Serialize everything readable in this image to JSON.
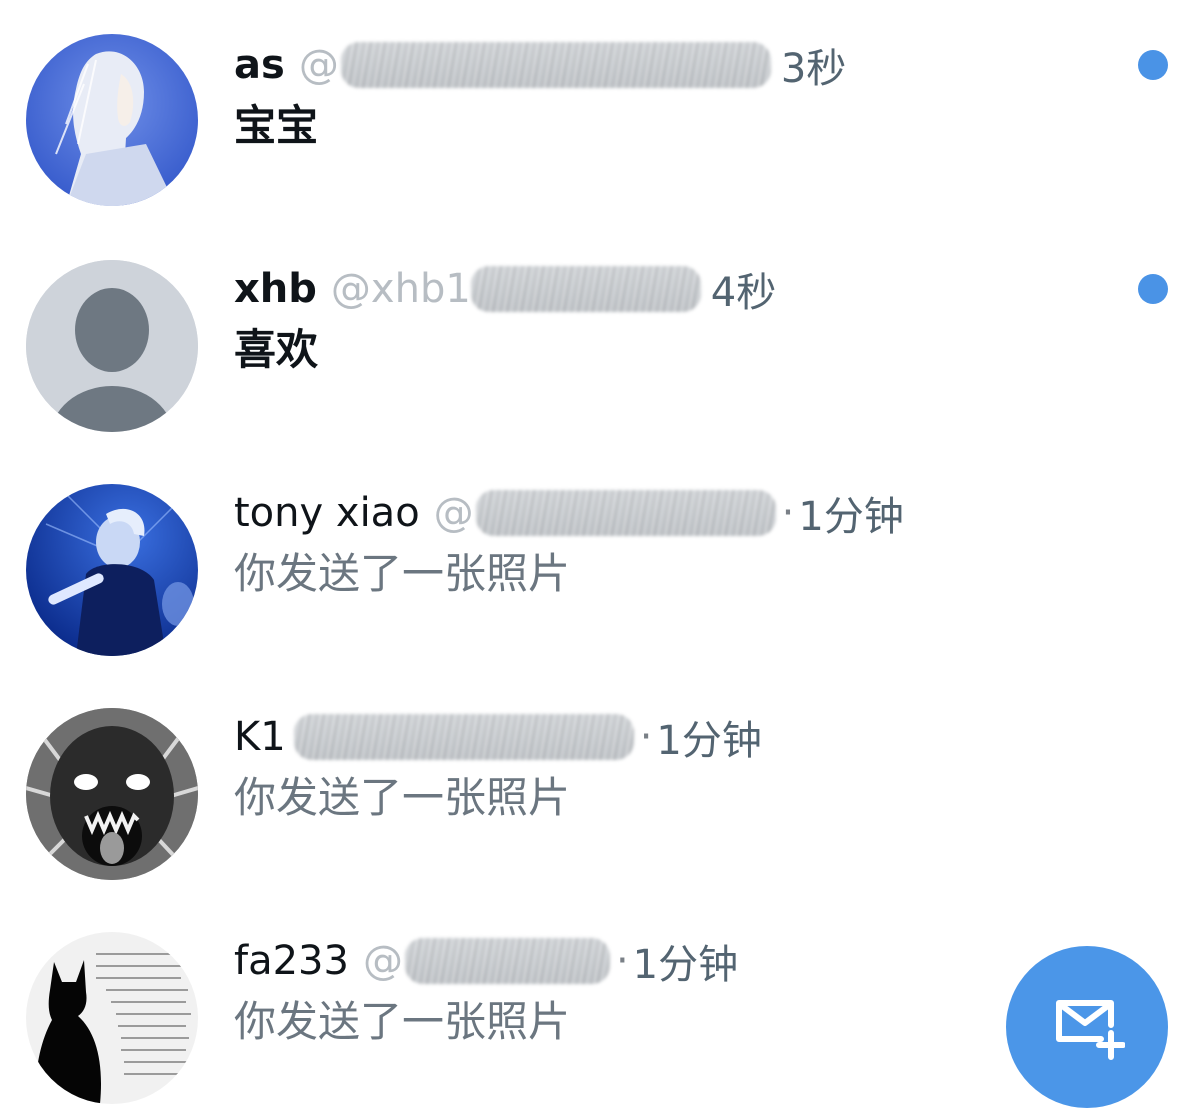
{
  "conversations": [
    {
      "name": "as",
      "handle_visible": "@",
      "separator": "",
      "time": "3秒",
      "preview": "宝宝",
      "unread": true,
      "avatar": "anime-character-avatar"
    },
    {
      "name": "xhb",
      "handle_visible": "@xhb1",
      "separator": "",
      "time": "4秒",
      "preview": "喜欢",
      "unread": true,
      "avatar": "default-person-avatar"
    },
    {
      "name": "tony xiao",
      "handle_visible": "@",
      "separator": "·",
      "time": "1分钟",
      "preview": "你发送了一张照片",
      "unread": false,
      "avatar": "singer-photo-avatar"
    },
    {
      "name": "K1",
      "handle_visible": "",
      "separator": "·",
      "time": "1分钟",
      "preview": "你发送了一张照片",
      "unread": false,
      "avatar": "monster-illustration-avatar"
    },
    {
      "name": "fa233",
      "handle_visible": "@",
      "separator": "·",
      "time": "1分钟",
      "preview": "你发送了一张照片",
      "unread": false,
      "avatar": "cat-silhouette-avatar"
    }
  ],
  "compose_button": {
    "icon": "new-message-icon"
  },
  "colors": {
    "accent": "#4b96e8",
    "unread_dot": "#4a93e6",
    "primary_text": "#0f1419",
    "secondary_text": "#6b7680"
  }
}
